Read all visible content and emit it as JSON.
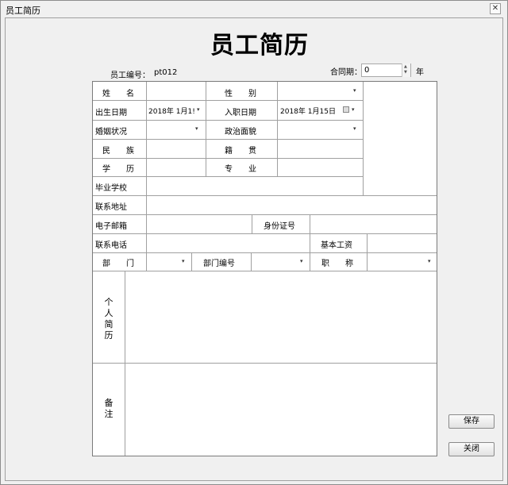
{
  "window": {
    "title": "员工简历",
    "close_glyph": "✕"
  },
  "heading": "员工简历",
  "employee_id": {
    "label": "员工编号：",
    "value": "pt012"
  },
  "contract": {
    "label": "合同期：",
    "value": "0",
    "unit": "年"
  },
  "form": {
    "name_label": "姓　　名",
    "gender_label": "性　　别",
    "birth_label": "出生日期",
    "birth_value": "2018年  1月1!",
    "hire_label": "入职日期",
    "hire_value": "2018年  1月15日",
    "marital_label": "婚姻状况",
    "political_label": "政治面貌",
    "ethnicity_label": "民　　族",
    "native_label": "籍　　贯",
    "education_label": "学　　历",
    "major_label": "专　　业",
    "school_label": "毕业学校",
    "address_label": "联系地址",
    "email_label": "电子邮箱",
    "idcard_label": "身份证号",
    "phone_label": "联系电话",
    "salary_label": "基本工资",
    "dept_label": "部　　门",
    "dept_code_label": "部门编号",
    "title_label": "职　　称",
    "resume_label": "个人简历",
    "remark_label": "备注"
  },
  "buttons": {
    "save": "保存",
    "close": "关闭"
  },
  "icons": {
    "dropdown": "▾",
    "spin_up": "▲",
    "spin_down": "▼"
  }
}
